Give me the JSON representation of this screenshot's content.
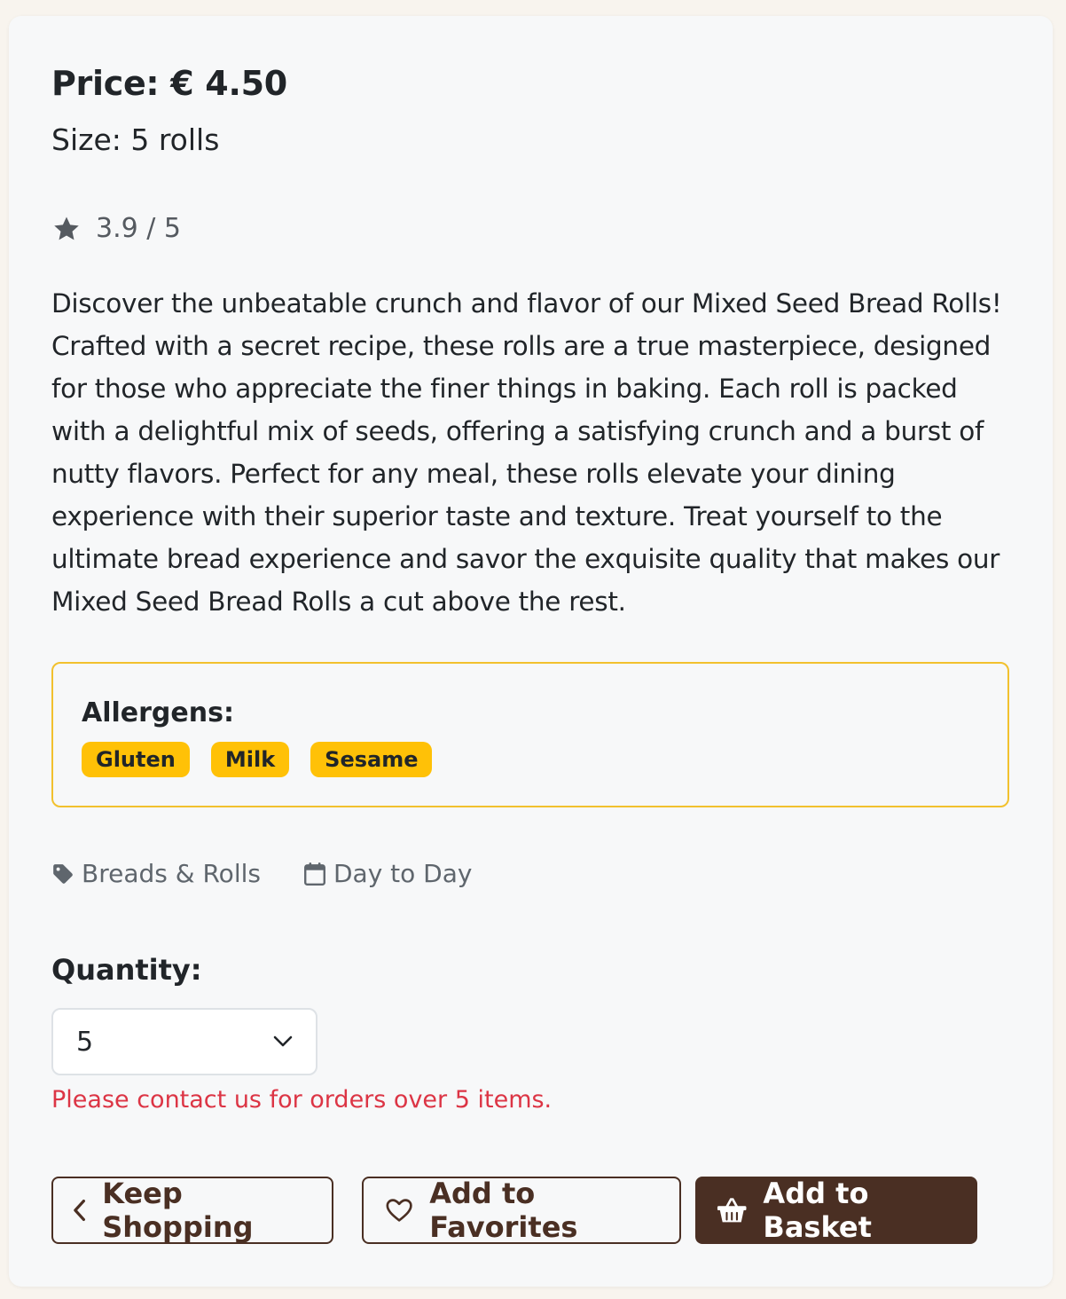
{
  "product": {
    "price_label": "Price: € 4.50",
    "size_label": "Size: 5 rolls",
    "rating_text": "3.9 / 5",
    "description": "Discover the unbeatable crunch and flavor of our Mixed Seed Bread Rolls! Crafted with a secret recipe, these rolls are a true masterpiece, designed for those who appreciate the finer things in baking. Each roll is packed with a delightful mix of seeds, offering a satisfying crunch and a burst of nutty flavors. Perfect for any meal, these rolls elevate your dining experience with their superior taste and texture. Treat yourself to the ultimate bread experience and savor the exquisite quality that makes our Mixed Seed Bread Rolls a cut above the rest."
  },
  "allergens": {
    "title": "Allergens:",
    "items": [
      "Gluten",
      "Milk",
      "Sesame"
    ]
  },
  "meta": {
    "category": "Breads & Rolls",
    "availability": "Day to Day"
  },
  "quantity": {
    "label": "Quantity:",
    "selected": "5",
    "warning": "Please contact us for orders over 5 items."
  },
  "actions": {
    "keep_shopping": "Keep Shopping",
    "add_favorites": "Add to Favorites",
    "add_basket": "Add to Basket"
  },
  "colors": {
    "brand_brown": "#4a2f23",
    "allergen_yellow": "#ffc107",
    "warning_red": "#dc3545"
  },
  "icons": [
    "star-icon",
    "tag-icon",
    "calendar-icon",
    "chevron-down-icon",
    "chevron-left-icon",
    "heart-icon",
    "basket-icon"
  ]
}
